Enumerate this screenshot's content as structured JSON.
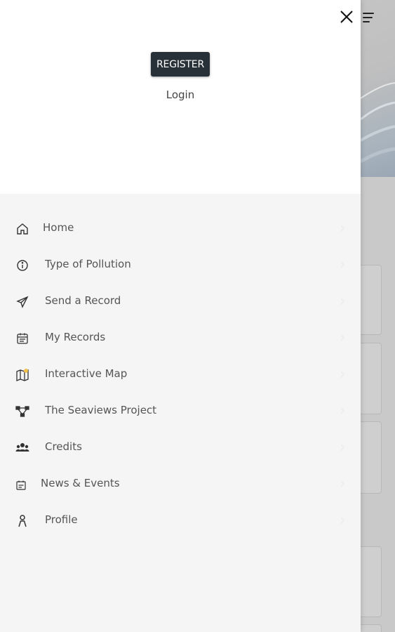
{
  "header": {
    "register_label": "REGISTER",
    "login_label": "Login"
  },
  "menu": {
    "items": [
      {
        "label": "Home",
        "icon": "home-icon"
      },
      {
        "label": "Type of Pollution",
        "icon": "info-icon"
      },
      {
        "label": "Send a Record",
        "icon": "send-icon"
      },
      {
        "label": "My Records",
        "icon": "calendar-icon"
      },
      {
        "label": "Interactive Map",
        "icon": "map-icon"
      },
      {
        "label": "The Seaviews Project",
        "icon": "network-icon"
      },
      {
        "label": "Credits",
        "icon": "people-icon"
      },
      {
        "label": "News & Events",
        "icon": "news-icon"
      },
      {
        "label": "Profile",
        "icon": "person-icon"
      }
    ]
  },
  "colors": {
    "drawer_bg": "#f5f5f5",
    "header_bg": "#ffffff",
    "register_bg": "#283138",
    "text": "#555555",
    "overlay": "#c9c9c9"
  }
}
